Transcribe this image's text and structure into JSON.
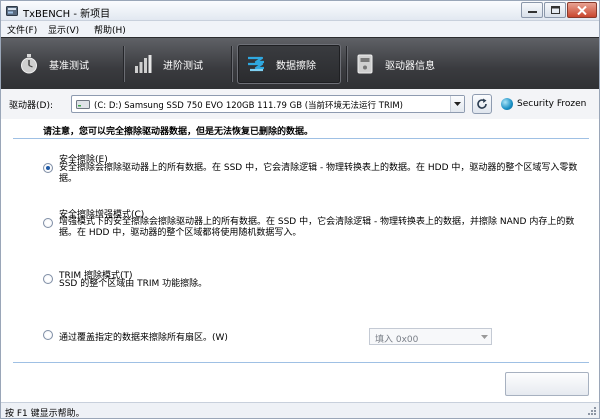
{
  "window": {
    "title": "TxBENCH - 新项目"
  },
  "menu": [
    "文件(F)",
    "显示(V)",
    "帮助(H)"
  ],
  "tabs": [
    "基准测试",
    "进阶测试",
    "数据擦除",
    "驱动器信息"
  ],
  "active_tab": "数据擦除",
  "drive": {
    "label": "驱动器(D):",
    "selected": "(C: D:) Samsung SSD 750 EVO 120GB  111.79 GB (当前环境无法运行 TRIM)",
    "security_status": "Security Frozen"
  },
  "warning": "请注意，您可以完全擦除驱动器数据，但是无法恢复已删除的数据。",
  "options": [
    {
      "title": "安全擦除(E)",
      "desc": "安全擦除会擦除驱动器上的所有数据。在 SSD 中，它会清除逻辑 - 物理转换表上的数据。在 HDD 中，驱动器的整个区域写入零数据。",
      "checked": true
    },
    {
      "title": "安全擦除增强模式(C)",
      "desc": "增强模式下的安全擦除会擦除驱动器上的所有数据。在 SSD 中，它会清除逻辑 - 物理转换表上的数据，并擦除 NAND 内存上的数据。在 HDD 中，驱动器的整个区域都将使用随机数据写入。",
      "checked": false
    },
    {
      "title": "TRIM 擦除模式(T)",
      "desc": "SSD 的整个区域由 TRIM 功能擦除。",
      "checked": false
    },
    {
      "title": "通过覆盖指定的数据来擦除所有扇区。(W)",
      "desc": "",
      "checked": false
    }
  ],
  "fill_select": "填入 0x00",
  "status": "按 F1 键显示帮助。",
  "colors": {
    "toolbar": "#3a3b3f",
    "accent": "#1a8fc4",
    "divider": "#9fc0e4"
  }
}
